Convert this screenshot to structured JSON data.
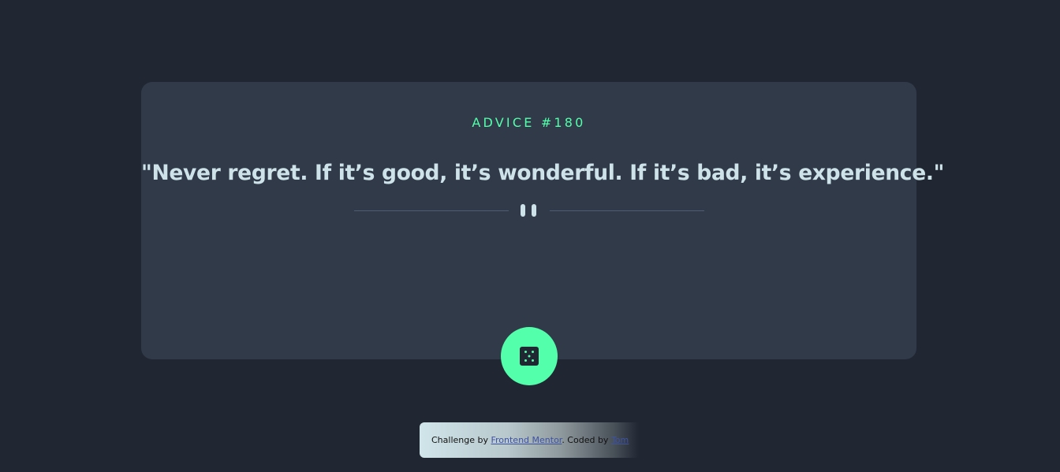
{
  "card": {
    "advice_label": "ADVICE #180",
    "quote": "\"Never regret. If it’s good, it’s wonderful. If it’s bad, it’s experience.\""
  },
  "icons": {
    "divider": "pause-icon",
    "button": "dice-icon"
  },
  "attribution": {
    "prefix": "Challenge by ",
    "link1": "Frontend Mentor",
    "middle": ". Coded by ",
    "link2": "Tom"
  },
  "colors": {
    "background": "#202632",
    "card": "#313a49",
    "accent": "#53ffaa",
    "text": "#cee3e9",
    "divider": "#4f5d74"
  }
}
